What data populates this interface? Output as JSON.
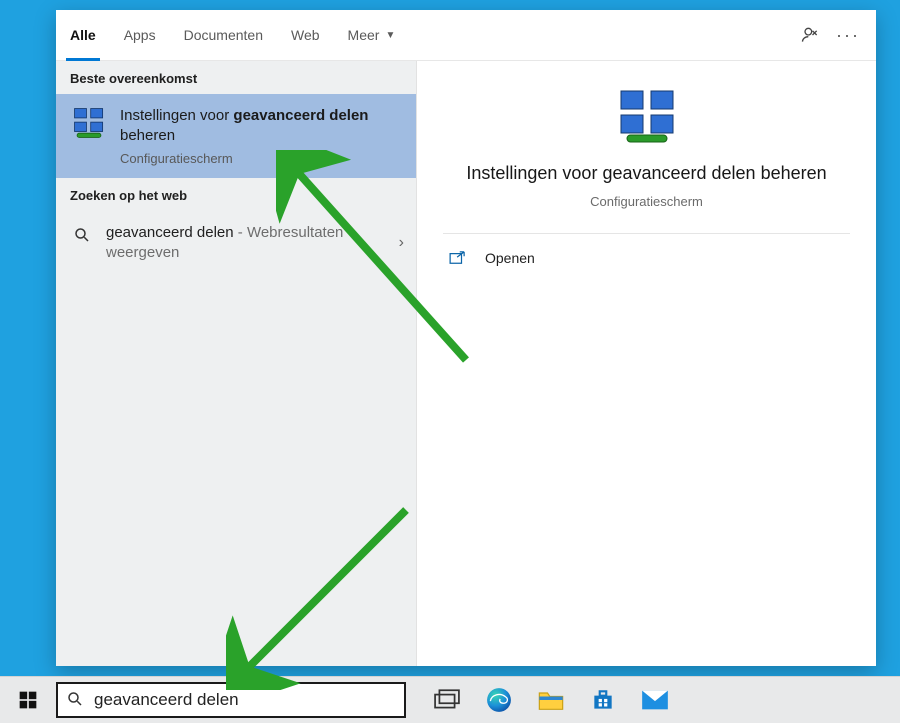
{
  "tabs": {
    "items": [
      "Alle",
      "Apps",
      "Documenten",
      "Web",
      "Meer"
    ],
    "active_index": 0
  },
  "left": {
    "best_match_header": "Beste overeenkomst",
    "result": {
      "title_pre": "Instellingen voor ",
      "title_bold": "geavanceerd delen",
      "title_post": " beheren",
      "subtitle": "Configuratiescherm"
    },
    "web_header": "Zoeken op het web",
    "web_item": {
      "query": "geavanceerd delen",
      "suffix": " - Webresultaten weergeven"
    }
  },
  "preview": {
    "title": "Instellingen voor geavanceerd delen beheren",
    "subtitle": "Configuratiescherm",
    "open_label": "Openen"
  },
  "taskbar": {
    "search_value": "geavanceerd delen"
  }
}
